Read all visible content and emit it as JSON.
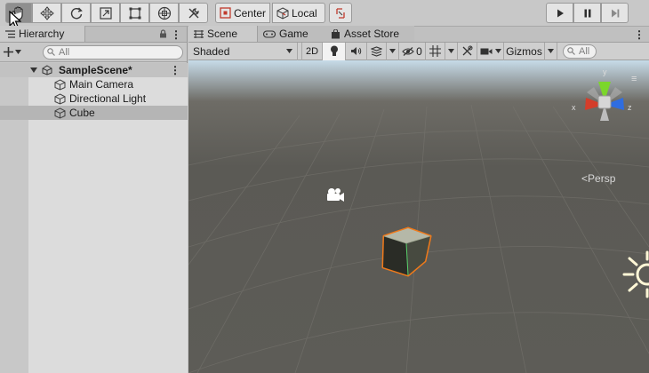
{
  "toolbar": {
    "tools": [
      {
        "name": "hand-tool",
        "active": true
      },
      {
        "name": "move-tool"
      },
      {
        "name": "rotate-tool"
      },
      {
        "name": "scale-tool"
      },
      {
        "name": "rect-tool"
      },
      {
        "name": "transform-tool"
      },
      {
        "name": "custom-tools"
      }
    ],
    "pivot_mode": "Center",
    "pivot_rotation": "Local"
  },
  "hierarchy": {
    "tab_label": "Hierarchy",
    "search_placeholder": "All",
    "scene_name": "SampleScene*",
    "items": [
      {
        "label": "Main Camera"
      },
      {
        "label": "Directional Light"
      },
      {
        "label": "Cube",
        "selected": true
      }
    ]
  },
  "scene_view": {
    "tabs": [
      {
        "label": "Scene",
        "active": true
      },
      {
        "label": "Game"
      },
      {
        "label": "Asset Store"
      }
    ],
    "shading_mode": "Shaded",
    "toggle_2d": "2D",
    "hidden_count": "0",
    "gizmos_label": "Gizmos",
    "search_placeholder": "All",
    "projection_label": "Persp",
    "axes": {
      "x": "x",
      "y": "y",
      "z": "z"
    }
  },
  "colors": {
    "selection_outline": "#f07a1a",
    "axis_x": "#d43d2a",
    "axis_y": "#7bd62b",
    "axis_z": "#2f6de0"
  }
}
